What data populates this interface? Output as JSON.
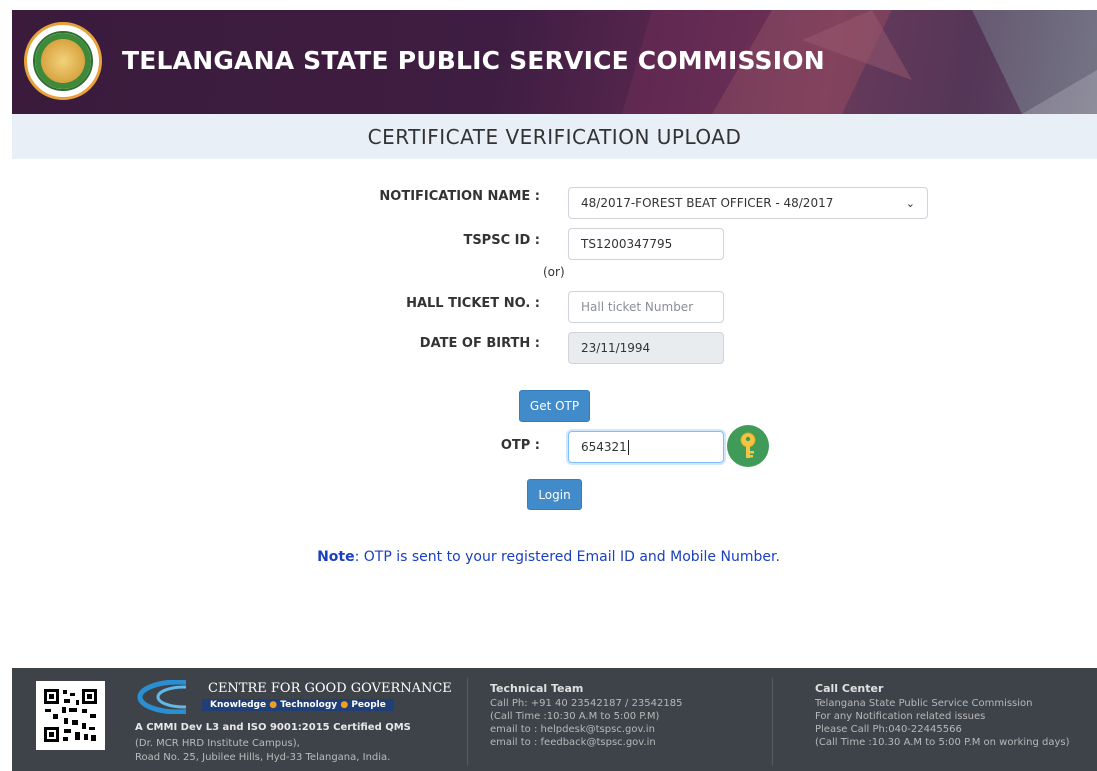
{
  "header": {
    "title": "TELANGANA STATE PUBLIC SERVICE COMMISSION",
    "logo_icon": "tspsc-emblem-icon"
  },
  "page": {
    "title": "CERTIFICATE VERIFICATION UPLOAD"
  },
  "form": {
    "notification_label": "NOTIFICATION NAME :",
    "notification_value": "48/2017-FOREST BEAT OFFICER - 48/2017",
    "tspsc_id_label": "TSPSC ID :",
    "tspsc_id_value": "TS1200347795",
    "or_text": "(or)",
    "hall_ticket_label": "HALL TICKET NO. :",
    "hall_ticket_placeholder": "Hall ticket Number",
    "dob_label": "DATE OF BIRTH :",
    "dob_value": "23/11/1994",
    "get_otp_label": "Get OTP",
    "otp_label": "OTP :",
    "otp_value": "654321",
    "login_label": "Login"
  },
  "note": {
    "prefix": "Note",
    "text": ": OTP is sent to your registered Email ID and Mobile Number."
  },
  "footer": {
    "cgg": {
      "name": "CENTRE FOR GOOD GOVERNANCE",
      "tag_1": "Knowledge",
      "tag_2": "Technology",
      "tag_3": "People",
      "cert": "A CMMI Dev L3 and ISO 9001:2015 Certified QMS",
      "addr_1": "(Dr. MCR HRD Institute Campus),",
      "addr_2": "Road No. 25, Jubilee Hills, Hyd-33 Telangana, India."
    },
    "technical": {
      "heading": "Technical Team",
      "lines": [
        "Call Ph: +91 40 23542187 / 23542185",
        "(Call Time :10:30 A.M to 5:00 P.M)",
        "email to : helpdesk@tspsc.gov.in",
        "email to : feedback@tspsc.gov.in"
      ]
    },
    "call_center": {
      "heading": "Call Center",
      "lines": [
        "Telangana State Public Service Commission",
        "For any Notification related issues",
        "Please Call Ph:040-22445566",
        "(Call Time :10.30 A.M to 5:00 P.M on working days)"
      ]
    }
  },
  "colors": {
    "banner": "#3f1d42",
    "button": "#428bca",
    "note": "#1a3fbf",
    "footer": "#3e4349",
    "key_icon_bg": "#3f9b57"
  }
}
